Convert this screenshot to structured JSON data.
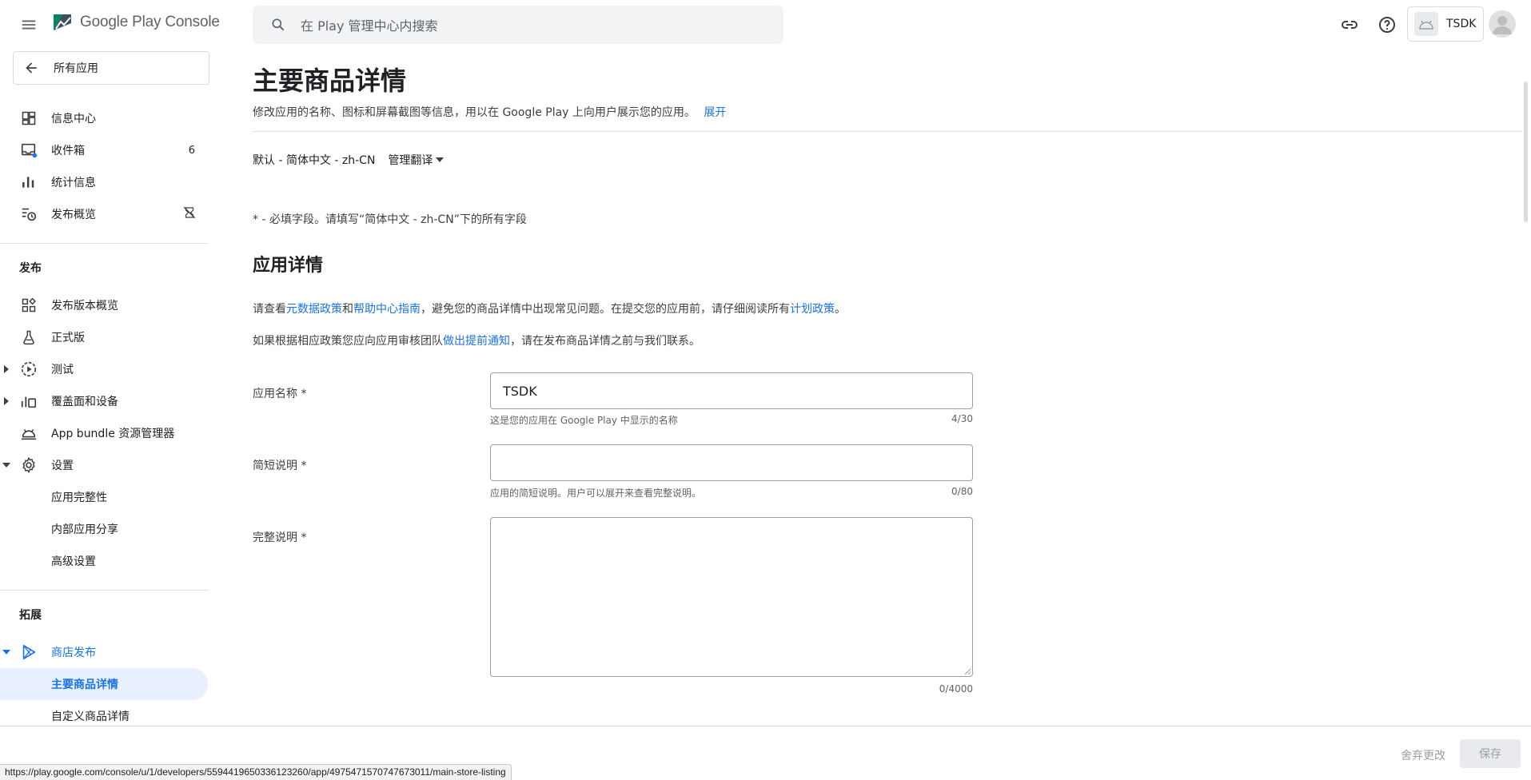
{
  "header": {
    "logo_brand": "Google Play",
    "logo_product": "Console",
    "search_placeholder": "在 Play 管理中心内搜索",
    "app_name": "TSDK"
  },
  "sidebar": {
    "all_apps": "所有应用",
    "items": [
      {
        "label": "信息中心",
        "icon": "dashboard-icon"
      },
      {
        "label": "收件箱",
        "icon": "inbox-icon",
        "badge": "6"
      },
      {
        "label": "统计信息",
        "icon": "bar-chart-icon"
      },
      {
        "label": "发布概览",
        "icon": "publishing-overview-icon"
      }
    ],
    "section_release": "发布",
    "release_items": [
      {
        "label": "发布版本概览"
      },
      {
        "label": "正式版"
      },
      {
        "label": "测试"
      },
      {
        "label": "覆盖面和设备"
      },
      {
        "label": "App bundle 资源管理器"
      },
      {
        "label": "设置"
      }
    ],
    "settings_sub": [
      "应用完整性",
      "内部应用分享",
      "高级设置"
    ],
    "section_grow": "拓展",
    "store_presence": "商店发布",
    "store_sub": [
      "主要商品详情",
      "自定义商品详情"
    ]
  },
  "main": {
    "title": "主要商品详情",
    "description": "修改应用的名称、图标和屏幕截图等信息，用以在 Google Play 上向用户展示您的应用。",
    "expand_link": "展开",
    "language": "默认 - 简体中文 - zh-CN",
    "manage_translations": "管理翻译",
    "required_note": "* - 必填字段。请填写“简体中文 - zh-CN”下的所有字段",
    "section_title": "应用详情",
    "policy1": {
      "t1": "请查看",
      "l1": "元数据政策",
      "t2": "和",
      "l2": "帮助中心指南",
      "t3": "，避免您的商品详情中出现常见问题。在提交您的应用前，请仔细阅读所有",
      "l3": "计划政策",
      "t4": "。"
    },
    "policy2": {
      "t1": "如果根据相应政策您应向应用审核团队",
      "l1": "做出提前通知",
      "t2": "，请在发布商品详情之前与我们联系。"
    },
    "fields": {
      "app_name": {
        "label": "应用名称 *",
        "value": "TSDK",
        "hint": "这是您的应用在 Google Play 中显示的名称",
        "counter": "4/30"
      },
      "short_desc": {
        "label": "简短说明 *",
        "value": "",
        "hint": "应用的简短说明。用户可以展开来查看完整说明。",
        "counter": "0/80"
      },
      "full_desc": {
        "label": "完整说明 *",
        "value": "",
        "counter": "0/4000"
      }
    }
  },
  "footer": {
    "discard": "舍弃更改",
    "save": "保存"
  },
  "status_url": "https://play.google.com/console/u/1/developers/5594419650336123260/app/4975471570747673011/main-store-listing",
  "colors": {
    "accent": "#1a73e8",
    "selected_bg": "#e8f0fe",
    "text": "#202124"
  }
}
